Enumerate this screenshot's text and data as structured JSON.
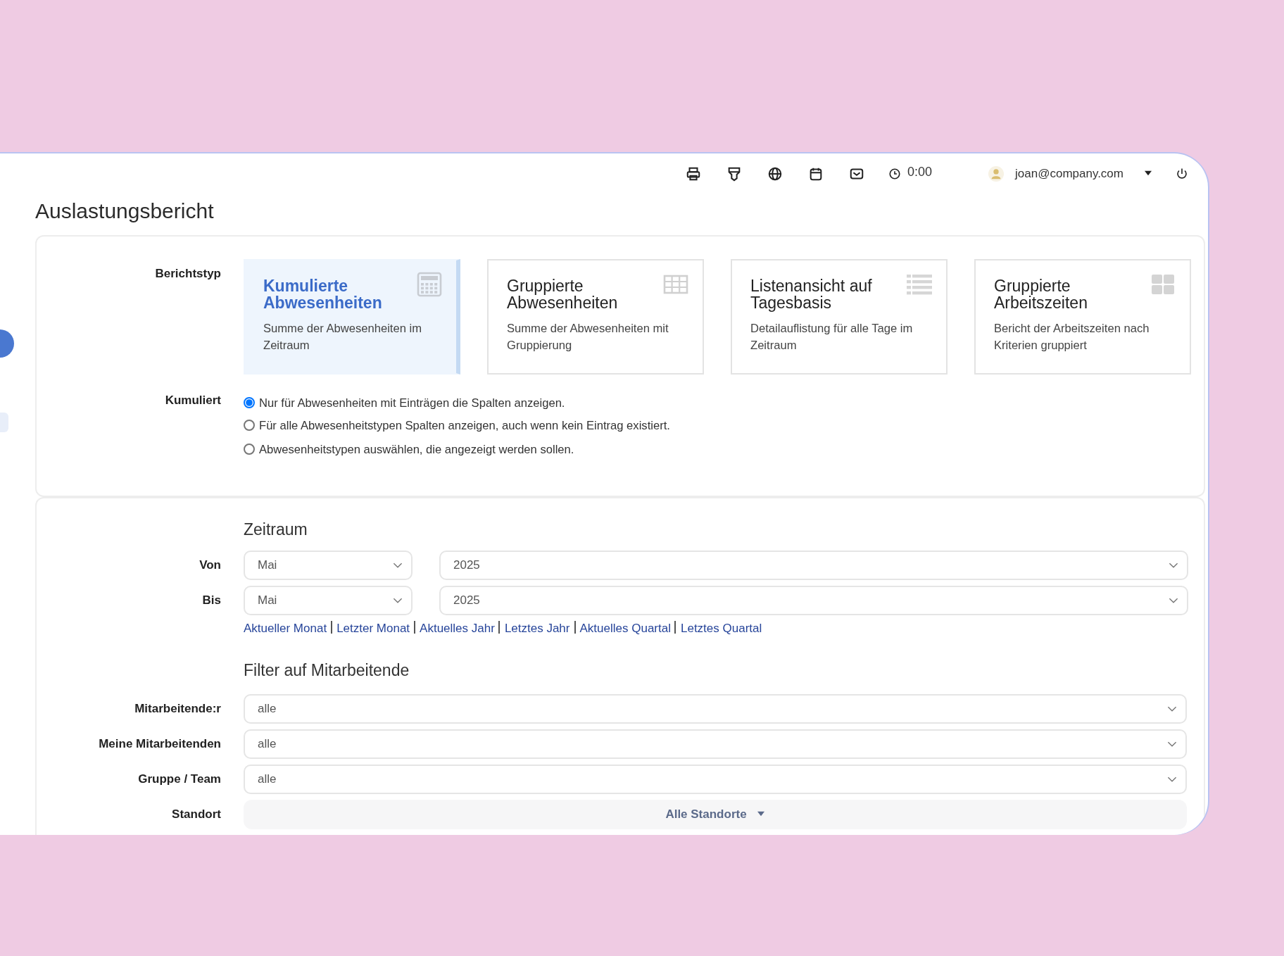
{
  "topbar": {
    "timer": "0:00",
    "user": "joan@company.com"
  },
  "title": "Auslastungsbericht",
  "report_type": {
    "label": "Berichtstyp",
    "options": [
      {
        "title": "Kumulierte Abwesenheiten",
        "description": "Summe der Abwesenheiten im Zeitraum",
        "kind": "calculator",
        "selected": true
      },
      {
        "title": "Gruppierte Abwesenheiten",
        "description": "Summe der Abwesenheiten mit Gruppierung",
        "kind": "table",
        "selected": false
      },
      {
        "title": "Listenansicht auf Tagesbasis",
        "description": "Detailauflistung für alle Tage im Zeitraum",
        "kind": "list",
        "selected": false
      },
      {
        "title": "Gruppierte Arbeitszeiten",
        "description": "Bericht der Arbeitszeiten nach Kriterien gruppiert",
        "kind": "grid",
        "selected": false
      }
    ]
  },
  "accumulated": {
    "label": "Kumuliert",
    "options": [
      {
        "text": "Nur für Abwesenheiten mit Einträgen die Spalten anzeigen.",
        "selected": true
      },
      {
        "text": "Für alle Abwesenheitstypen Spalten anzeigen, auch wenn kein Eintrag existiert.",
        "selected": false
      },
      {
        "text": "Abwesenheitstypen auswählen, die angezeigt werden sollen.",
        "selected": false
      }
    ]
  },
  "period": {
    "heading": "Zeitraum",
    "rows": [
      {
        "label": "Von",
        "month": "Mai",
        "year": "2025"
      },
      {
        "label": "Bis",
        "month": "Mai",
        "year": "2025"
      }
    ],
    "quick_links": [
      "Aktueller Monat",
      "Letzter Monat",
      "Aktuelles Jahr",
      "Letztes Jahr",
      "Aktuelles Quartal",
      "Letztes Quartal"
    ]
  },
  "filters": {
    "heading": "Filter auf Mitarbeitende",
    "rows": [
      {
        "label": "Mitarbeitende:r",
        "value": "alle",
        "kind": "select"
      },
      {
        "label": "Meine Mitarbeitenden",
        "value": "alle",
        "kind": "select"
      },
      {
        "label": "Gruppe / Team",
        "value": "alle",
        "kind": "select"
      },
      {
        "label": "Standort",
        "value": "Alle Standorte",
        "kind": "dropdown"
      }
    ]
  }
}
